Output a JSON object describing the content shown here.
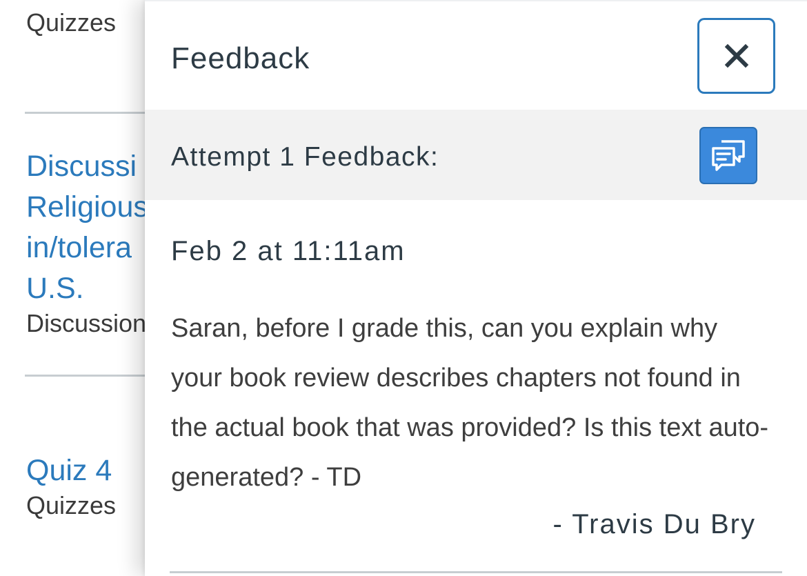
{
  "background_list": {
    "items": [
      {
        "title": "",
        "type": "Quizzes"
      },
      {
        "title_lines": [
          "Discussi",
          "Religious",
          "in/tolera",
          "U.S."
        ],
        "type": "Discussion"
      },
      {
        "title": "Quiz 4",
        "type": "Quizzes"
      }
    ]
  },
  "tray": {
    "title": "Feedback",
    "close_icon": "close-x-icon",
    "attempt_label": "Attempt 1 Feedback:",
    "comment_icon": "comments-icon",
    "timestamp": "Feb 2 at 11:11am",
    "comment_text": "Saran, before I grade this, can you explain why your book review describes chapters not found in the actual book that was provided? Is this text auto-generated? - TD",
    "author": "- Travis Du Bry"
  },
  "colors": {
    "link": "#2b7abc",
    "text_dark": "#2d3b45",
    "button_blue": "#3b89dc",
    "attempt_bar_bg": "#f2f2f2"
  }
}
